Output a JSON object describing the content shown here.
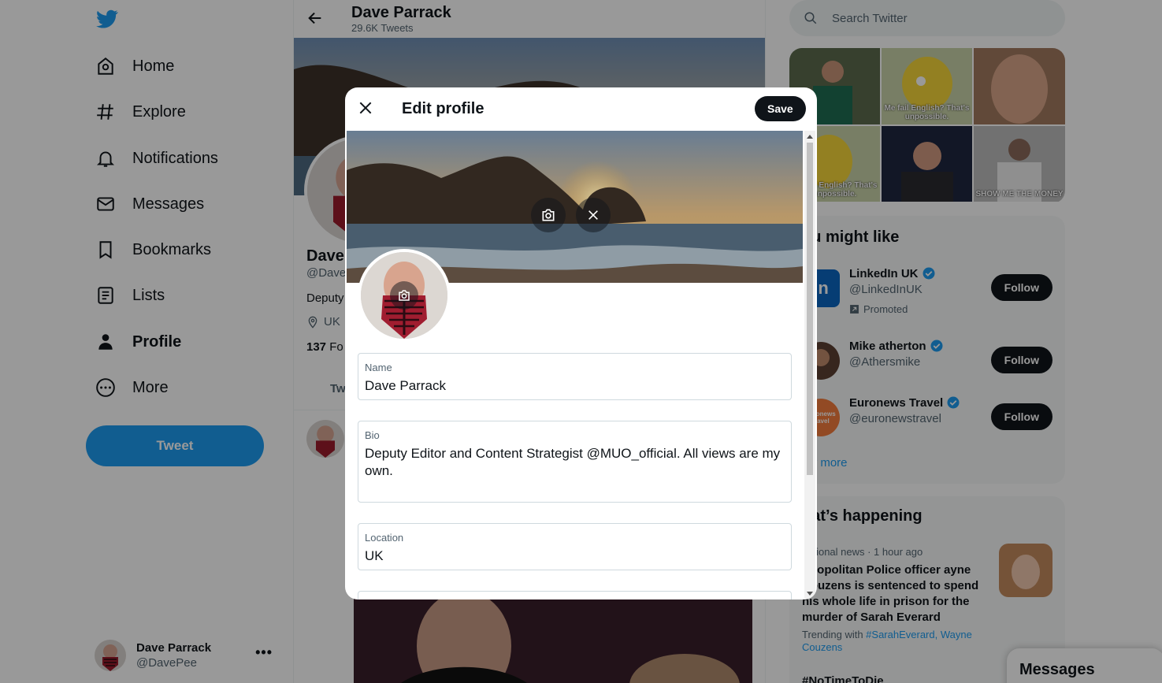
{
  "nav": {
    "items": [
      {
        "label": "Home",
        "icon": "home-icon"
      },
      {
        "label": "Explore",
        "icon": "hashtag-icon"
      },
      {
        "label": "Notifications",
        "icon": "bell-icon"
      },
      {
        "label": "Messages",
        "icon": "envelope-icon"
      },
      {
        "label": "Bookmarks",
        "icon": "bookmark-icon"
      },
      {
        "label": "Lists",
        "icon": "list-icon"
      },
      {
        "label": "Profile",
        "icon": "person-icon"
      },
      {
        "label": "More",
        "icon": "more-circle-icon"
      }
    ],
    "active": "Profile",
    "tweet_label": "Tweet",
    "account": {
      "name": "Dave Parrack",
      "handle": "@DavePee",
      "menu": "•••"
    }
  },
  "main": {
    "title": "Dave Parrack",
    "subtitle": "29.6K Tweets",
    "profile_name": "Dave",
    "profile_handle": "@Dave",
    "bio_start": "Deputy",
    "location": "UK",
    "following_count": "137",
    "following_label": "Fo",
    "tab": "Tw"
  },
  "right": {
    "search_placeholder": "Search Twitter",
    "gif_captions": [
      "Me fail English? That's unpossible.",
      "Me fail English? That's unpossible.",
      "SHOW ME THE MONEY"
    ],
    "wtf_title": "ou might like",
    "suggestions": [
      {
        "name": "LinkedIn UK",
        "handle": "@LinkedInUK",
        "promoted": "Promoted",
        "button": "Follow",
        "avatar_text": "in"
      },
      {
        "name": "Mike atherton",
        "handle": "@Athersmike",
        "button": "Follow"
      },
      {
        "name": "Euronews Travel",
        "handle": "@euronewstravel",
        "button": "Follow",
        "avatar_text": "euronews travel"
      }
    ],
    "show_more": "ow more",
    "happening_title": "hat’s happening",
    "trend": {
      "meta": "national news · 1 hour ago",
      "text": "etropolitan Police officer ayne Couzens is sentenced to spend his whole life in prison for the murder of Sarah Everard",
      "with_prefix": "Trending with ",
      "with_links": "#SarahEverard, Wayne Couzens",
      "next": "#NoTimeToDie"
    },
    "messages_drawer": "Messages"
  },
  "modal": {
    "title": "Edit profile",
    "save_label": "Save",
    "fields": {
      "name_label": "Name",
      "name_value": "Dave Parrack",
      "bio_label": "Bio",
      "bio_value": "Deputy Editor and Content Strategist @MUO_official. All views are my own.",
      "location_label": "Location",
      "location_value": "UK"
    }
  },
  "colors": {
    "accent": "#1d9bf0",
    "dark": "#0f1419",
    "muted": "#536471",
    "verified": "#1d9bf0"
  }
}
